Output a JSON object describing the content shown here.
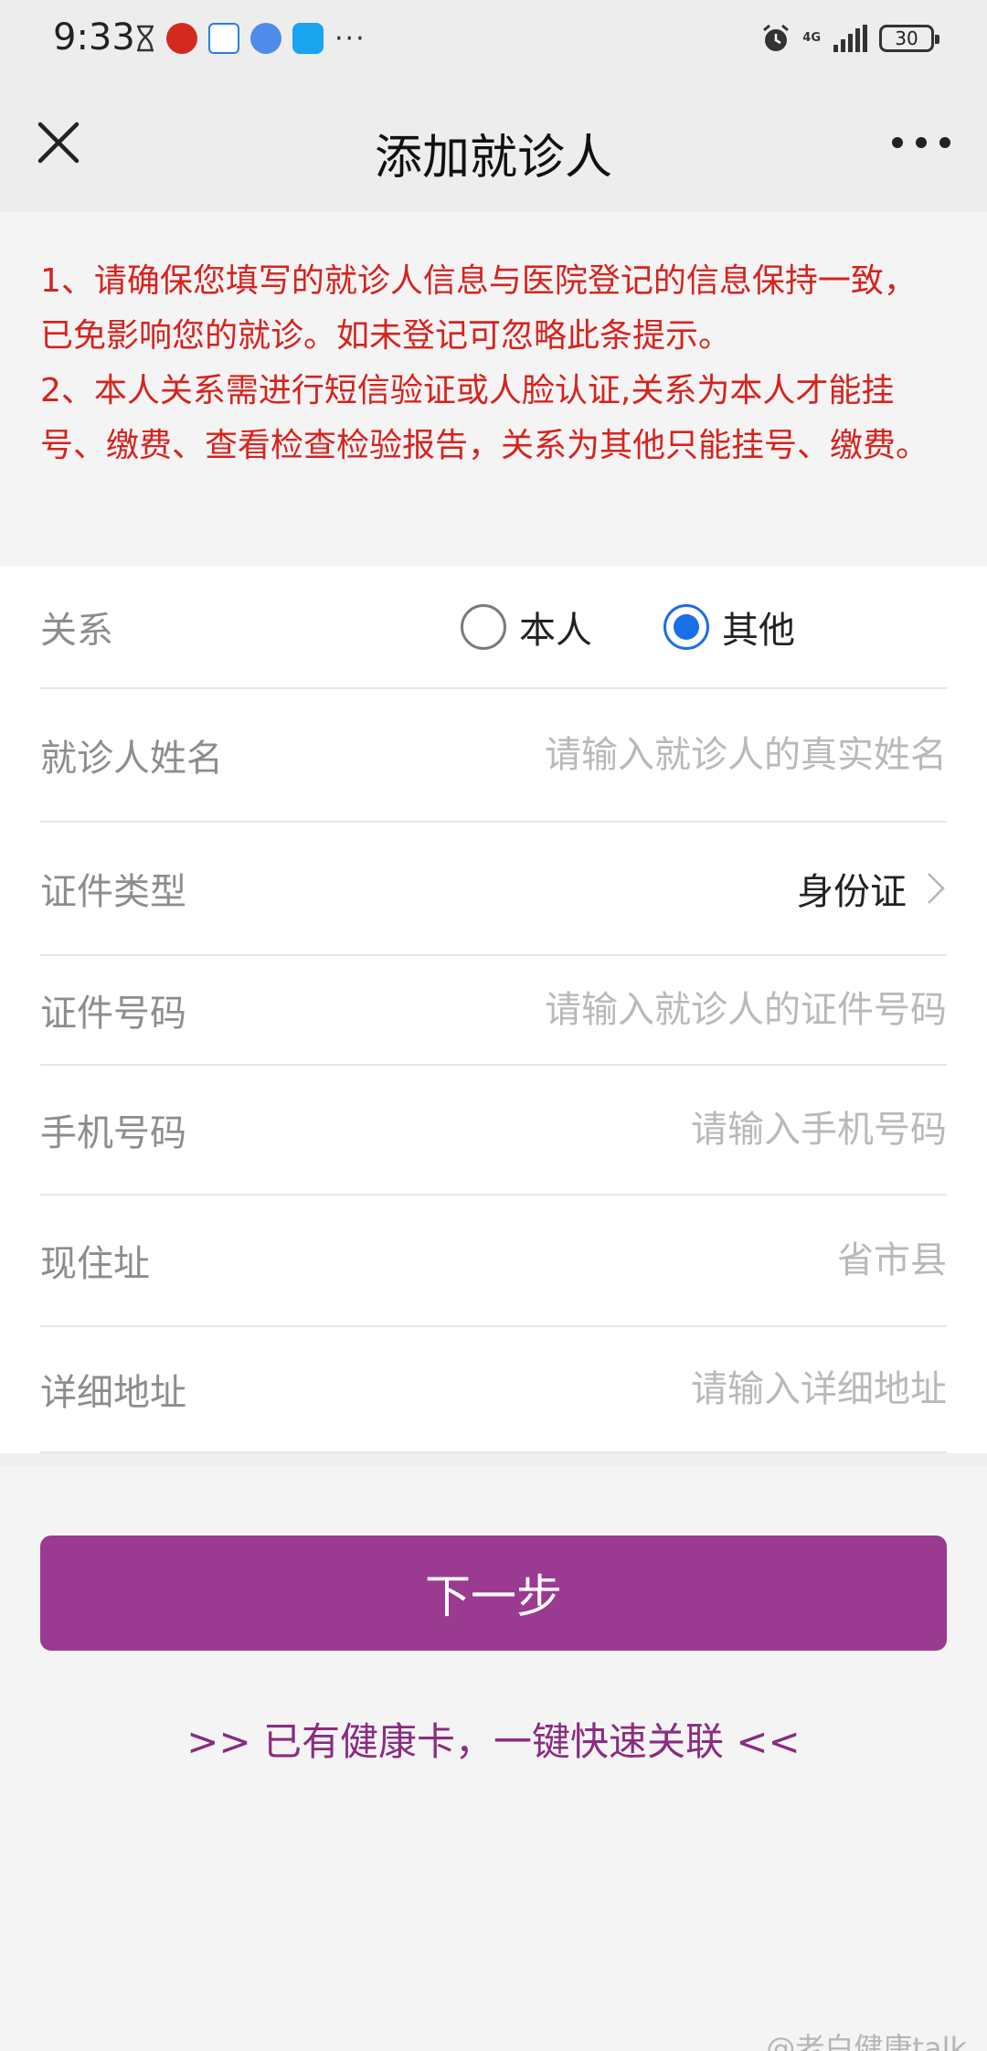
{
  "status_bar": {
    "time": "9:33",
    "network": "4G",
    "battery": "30"
  },
  "header": {
    "title": "添加就诊人"
  },
  "notice": {
    "line1": "1、请确保您填写的就诊人信息与医院登记的信息保持一致，已免影响您的就诊。如未登记可忽略此条提示。",
    "line2": "2、本人关系需进行短信验证或人脸认证,关系为本人才能挂号、缴费、查看检查检验报告，关系为其他只能挂号、缴费。"
  },
  "form": {
    "relation": {
      "label": "关系",
      "options": [
        "本人",
        "其他"
      ],
      "selected": "其他"
    },
    "name": {
      "label": "就诊人姓名",
      "placeholder": "请输入就诊人的真实姓名"
    },
    "id_type": {
      "label": "证件类型",
      "value": "身份证"
    },
    "id_number": {
      "label": "证件号码",
      "placeholder": "请输入就诊人的证件号码"
    },
    "phone": {
      "label": "手机号码",
      "placeholder": "请输入手机号码"
    },
    "address": {
      "label": "现住址",
      "placeholder": "省市县"
    },
    "detail_address": {
      "label": "详细地址",
      "placeholder": "请输入详细地址"
    }
  },
  "actions": {
    "next_label": "下一步",
    "link_label": ">> 已有健康卡，一键快速关联 <<"
  },
  "watermark": "@老白健康talk",
  "colors": {
    "accent": "#9a3a90",
    "notice": "#d6231d",
    "radio": "#1a6fe6"
  },
  "icons": [
    "close-icon",
    "more-icon",
    "chevron-right-icon",
    "alarm-icon",
    "signal-icon",
    "battery-icon"
  ]
}
